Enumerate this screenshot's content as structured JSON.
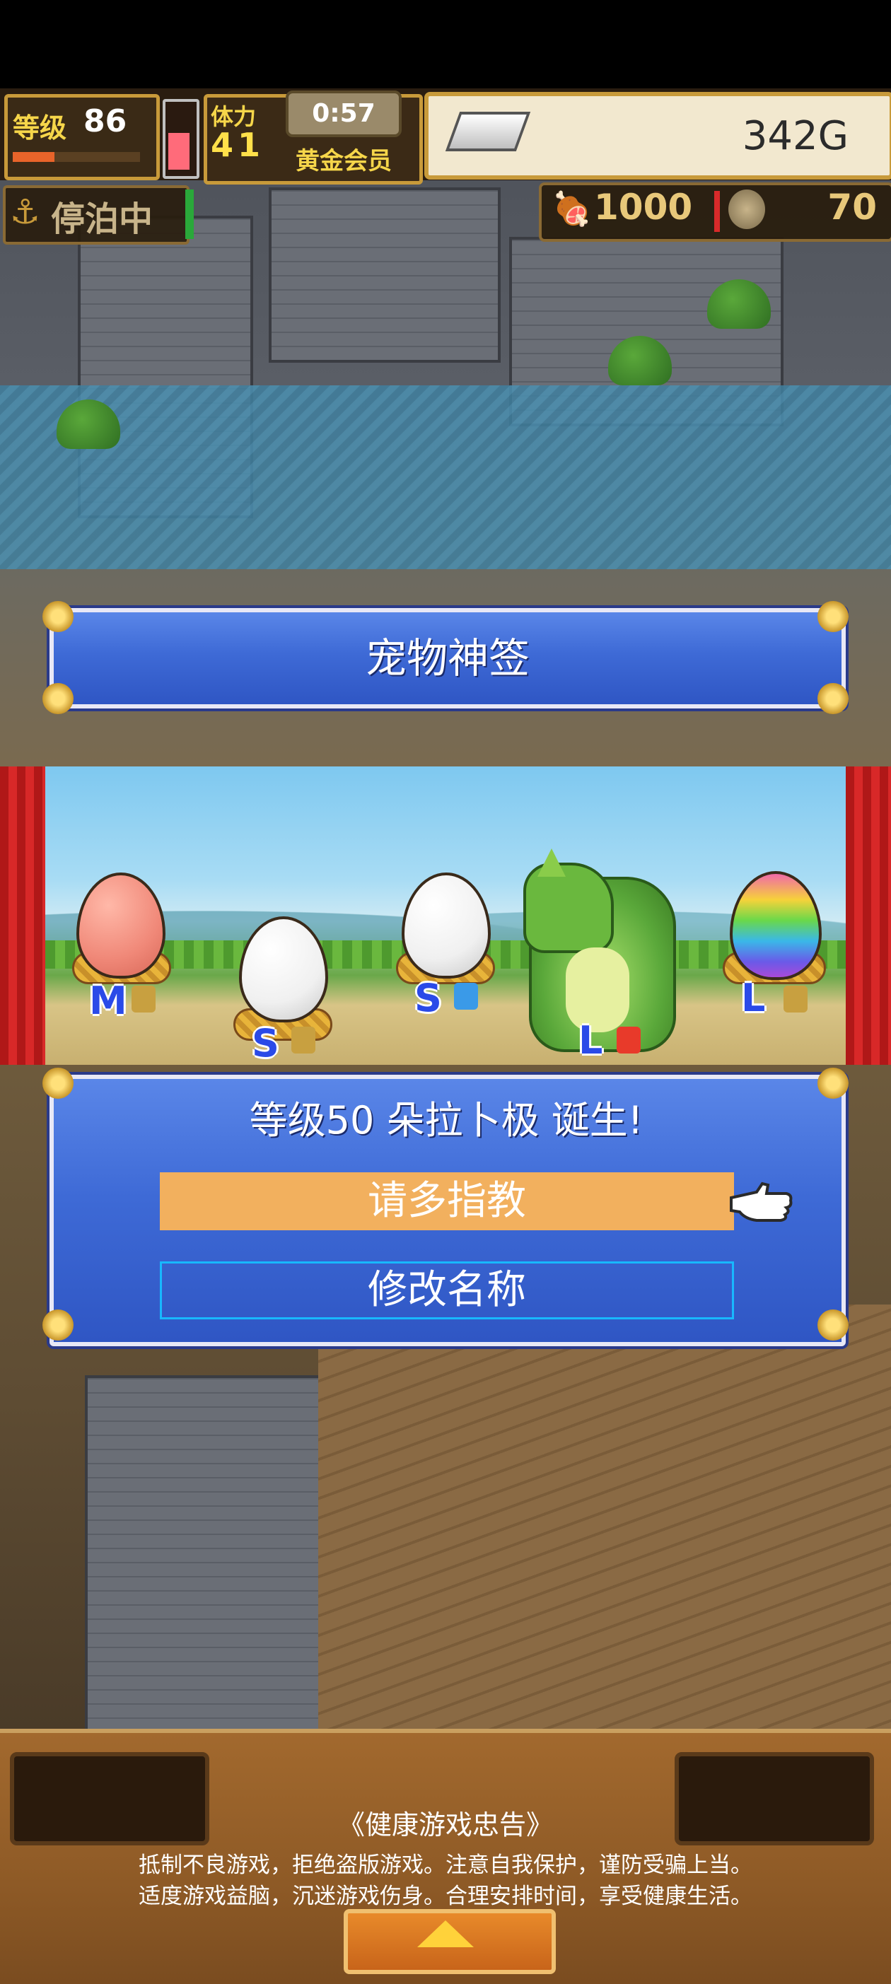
{
  "status": {
    "level_label": "等级",
    "level_value": "86",
    "level_progress": 0.33,
    "stamina_label": "体力",
    "stamina_value": "41",
    "timer": "0:57",
    "member": "黄金会员",
    "gold": "342G"
  },
  "secondary": {
    "anchor_label": "停泊中",
    "food": "1000",
    "coins": "70"
  },
  "title_banner": "宠物神签",
  "eggs": [
    {
      "size": "M",
      "color": "#f08878",
      "element": "earth"
    },
    {
      "size": "S",
      "color": "#f6f6f6",
      "element": "earth"
    },
    {
      "size": "S",
      "color": "#f6f6f6",
      "element": "water"
    },
    {
      "size": "L",
      "color": "dragon",
      "element": "fire"
    },
    {
      "size": "L",
      "color": "rainbow",
      "element": "earth"
    }
  ],
  "dialog": {
    "message": "等级50 朵拉卜极 诞生!",
    "confirm_button": "请多指教",
    "rename_button": "修改名称"
  },
  "advisory": {
    "title": "《健康游戏忠告》",
    "line1": "抵制不良游戏，拒绝盗版游戏。注意自我保护，谨防受骗上当。",
    "line2": "适度游戏益脑，沉迷游戏伤身。合理安排时间，享受健康生活。"
  },
  "colors": {
    "dialog_blue": "#3e6ad6",
    "confirm_orange": "#f2b05e",
    "rename_border": "#18b8ff"
  }
}
